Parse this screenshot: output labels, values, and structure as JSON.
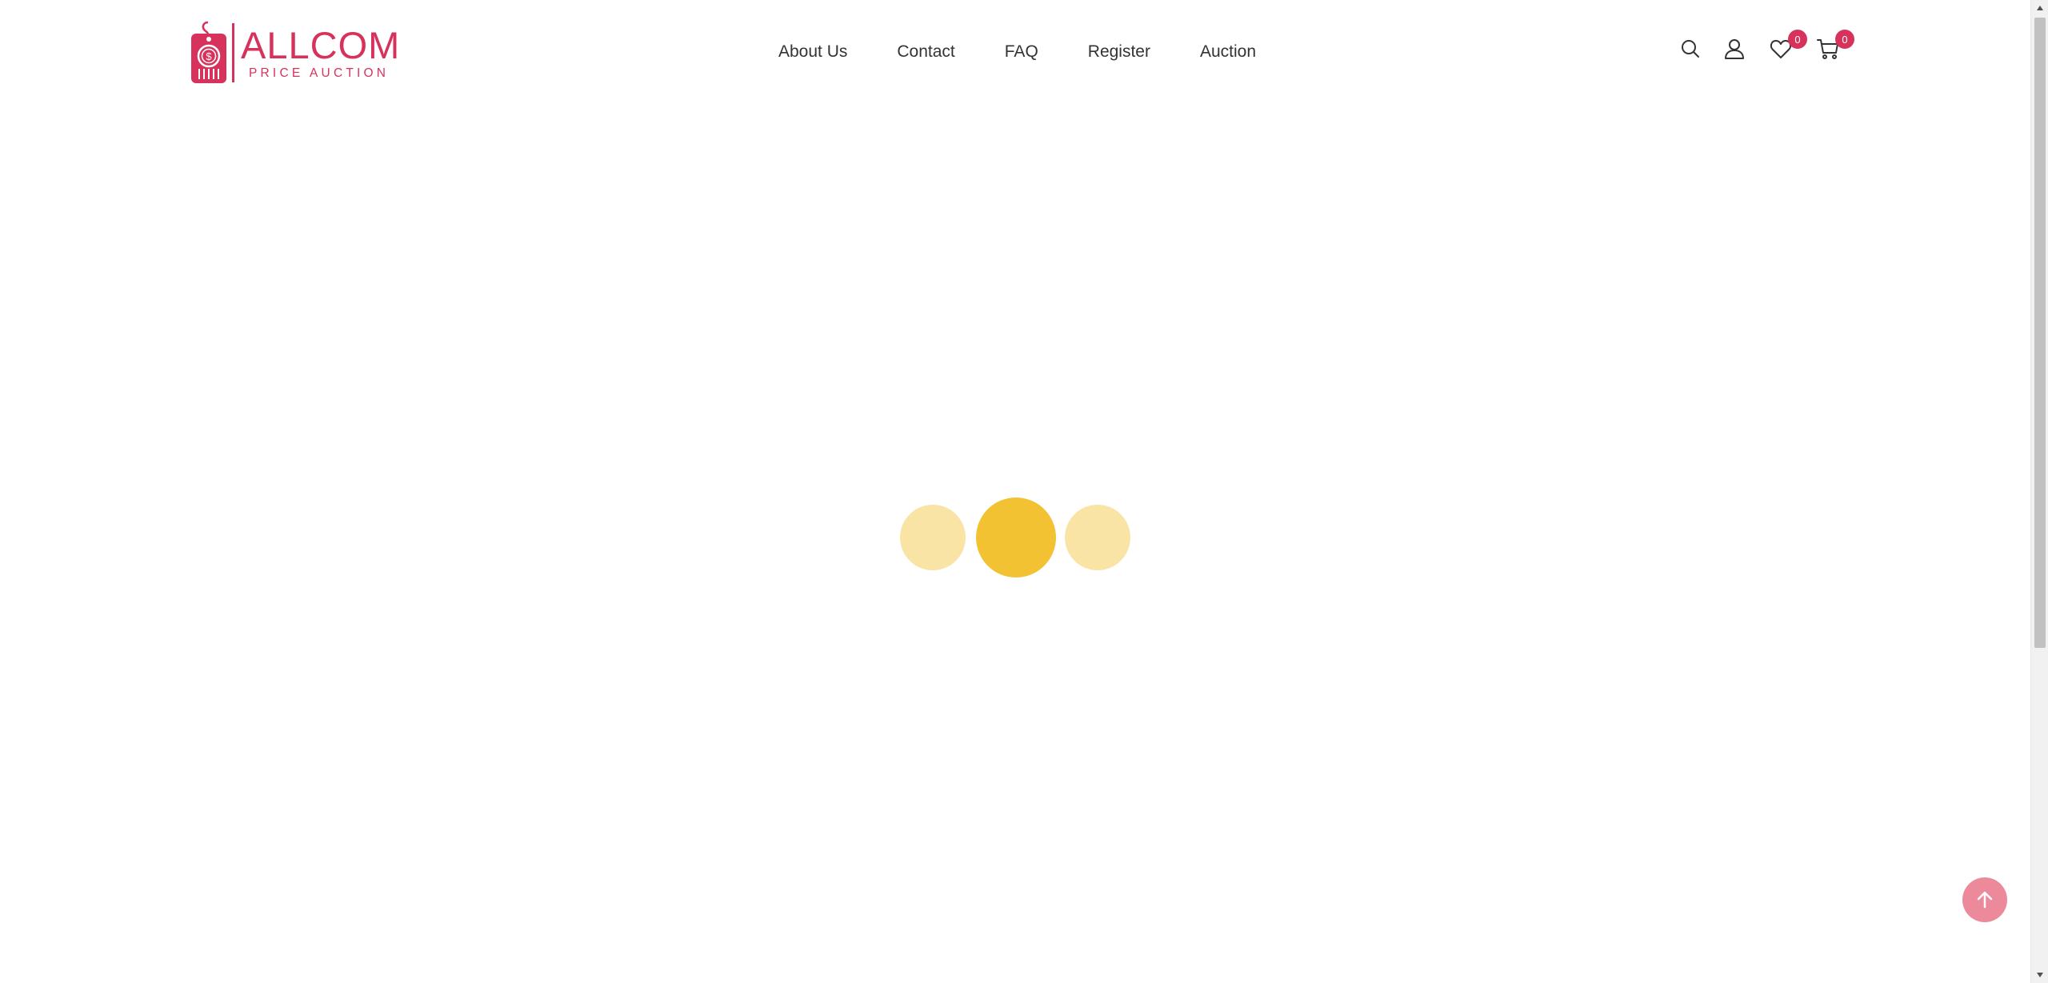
{
  "brand": {
    "title": "ALLCOM",
    "subtitle": "PRICE AUCTION",
    "color": "#d6325c"
  },
  "nav": {
    "items": [
      {
        "label": "About Us"
      },
      {
        "label": "Contact"
      },
      {
        "label": "FAQ"
      },
      {
        "label": "Register"
      },
      {
        "label": "Auction"
      }
    ]
  },
  "header_icons": {
    "search": "search-icon",
    "account": "user-icon",
    "wishlist": {
      "icon": "heart-icon",
      "count": "0"
    },
    "cart": {
      "icon": "cart-icon",
      "count": "0"
    }
  },
  "loader": {
    "colors": {
      "active": "#f2c232",
      "inactive": "#f9e4a6"
    },
    "dots": 3,
    "active_index": 1
  },
  "back_to_top": {
    "icon": "arrow-up-icon",
    "color": "#ec8a9c"
  }
}
